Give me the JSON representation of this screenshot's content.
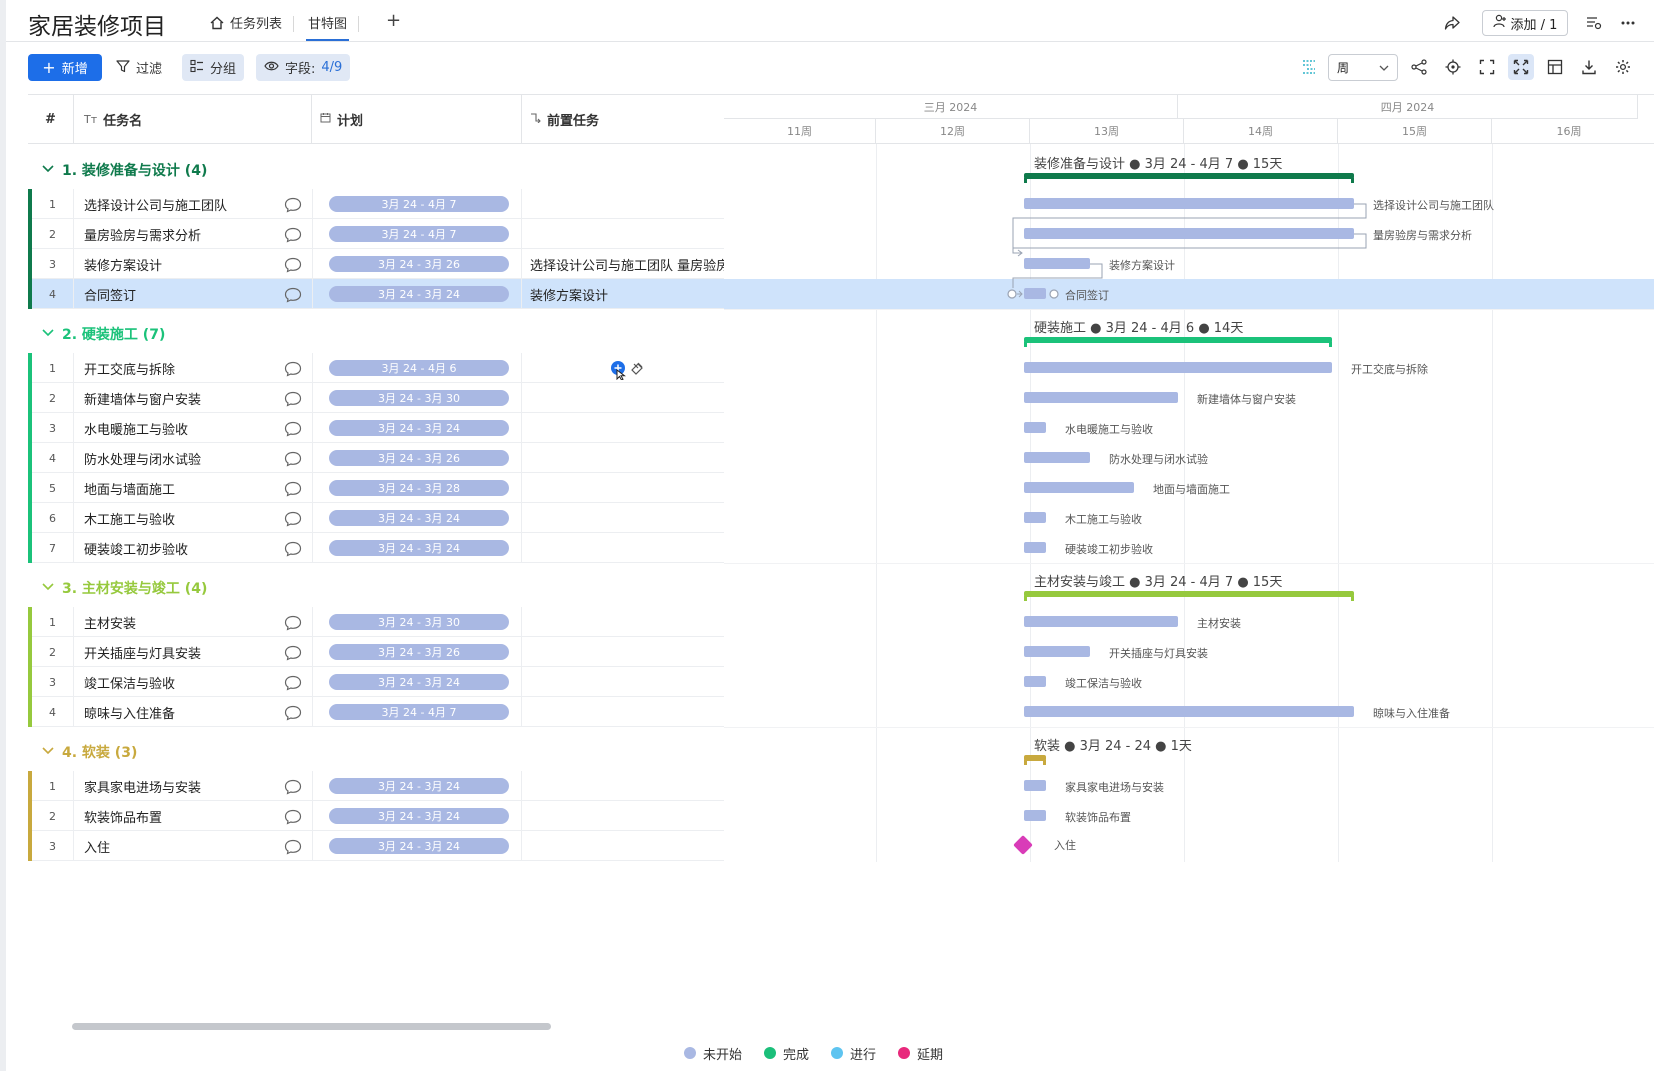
{
  "header": {
    "title": "家居装修项目",
    "tabs": [
      {
        "label": "任务列表"
      },
      {
        "label": "甘特图"
      }
    ],
    "add_label": "添加 / 1"
  },
  "toolbar": {
    "new_label": "新增",
    "filter_label": "过滤",
    "group_label": "分组",
    "fields_label": "字段:",
    "fields_count": "4/9",
    "view_select": "周"
  },
  "grid": {
    "columns": [
      {
        "label": "#"
      },
      {
        "label": "任务名"
      },
      {
        "label": "计划"
      },
      {
        "label": "前置任务"
      }
    ]
  },
  "timeline": {
    "months": [
      {
        "label": "三月 2024"
      },
      {
        "label": "四月 2024"
      }
    ],
    "weeks": [
      {
        "label": "11周"
      },
      {
        "label": "12周"
      },
      {
        "label": "13周"
      },
      {
        "label": "14周"
      },
      {
        "label": "15周"
      },
      {
        "label": "16周"
      }
    ]
  },
  "groups": [
    {
      "title": "1. 装修准备与设计 (4)",
      "color": "#0f7a4c",
      "summary": "装修准备与设计 ● 3月 24 - 4月 7 ● 15天",
      "tasks": [
        {
          "idx": "1",
          "name": "选择设计公司与施工团队",
          "plan": "3月 24 - 4月 7",
          "pred": ""
        },
        {
          "idx": "2",
          "name": "量房验房与需求分析",
          "plan": "3月 24 - 4月 7",
          "pred": ""
        },
        {
          "idx": "3",
          "name": "装修方案设计",
          "plan": "3月 24 - 3月 26",
          "pred": "选择设计公司与施工团队  量房验房与需求分析"
        },
        {
          "idx": "4",
          "name": "合同签订",
          "plan": "3月 24 - 3月 24",
          "pred": "装修方案设计"
        }
      ]
    },
    {
      "title": "2. 硬装施工 (7)",
      "color": "#1bc27a",
      "summary": "硬装施工 ● 3月 24 - 4月 6 ● 14天",
      "tasks": [
        {
          "idx": "1",
          "name": "开工交底与拆除",
          "plan": "3月 24 - 4月 6",
          "pred": ""
        },
        {
          "idx": "2",
          "name": "新建墙体与窗户安装",
          "plan": "3月 24 - 3月 30",
          "pred": ""
        },
        {
          "idx": "3",
          "name": "水电暖施工与验收",
          "plan": "3月 24 - 3月 24",
          "pred": ""
        },
        {
          "idx": "4",
          "name": "防水处理与闭水试验",
          "plan": "3月 24 - 3月 26",
          "pred": ""
        },
        {
          "idx": "5",
          "name": "地面与墙面施工",
          "plan": "3月 24 - 3月 28",
          "pred": ""
        },
        {
          "idx": "6",
          "name": "木工施工与验收",
          "plan": "3月 24 - 3月 24",
          "pred": ""
        },
        {
          "idx": "7",
          "name": "硬装竣工初步验收",
          "plan": "3月 24 - 3月 24",
          "pred": ""
        }
      ]
    },
    {
      "title": "3. 主材安装与竣工 (4)",
      "color": "#96c93d",
      "summary": "主材安装与竣工 ● 3月 24 - 4月 7 ● 15天",
      "tasks": [
        {
          "idx": "1",
          "name": "主材安装",
          "plan": "3月 24 - 3月 30",
          "pred": ""
        },
        {
          "idx": "2",
          "name": "开关插座与灯具安装",
          "plan": "3月 24 - 3月 26",
          "pred": ""
        },
        {
          "idx": "3",
          "name": "竣工保洁与验收",
          "plan": "3月 24 - 3月 24",
          "pred": ""
        },
        {
          "idx": "4",
          "name": "晾味与入住准备",
          "plan": "3月 24 - 4月 7",
          "pred": ""
        }
      ]
    },
    {
      "title": "4. 软装 (3)",
      "color": "#c8a93e",
      "summary": "软装 ● 3月 24 - 24 ● 1天",
      "tasks": [
        {
          "idx": "1",
          "name": "家具家电进场与安装",
          "plan": "3月 24 - 3月 24",
          "pred": ""
        },
        {
          "idx": "2",
          "name": "软装饰品布置",
          "plan": "3月 24 - 3月 24",
          "pred": ""
        },
        {
          "idx": "3",
          "name": "入住",
          "plan": "3月 24 - 3月 24",
          "pred": ""
        }
      ]
    }
  ],
  "legend": [
    {
      "label": "未开始",
      "color": "#a9b8e3"
    },
    {
      "label": "完成",
      "color": "#1bbf7a"
    },
    {
      "label": "进行",
      "color": "#5ec4f0"
    },
    {
      "label": "延期",
      "color": "#e8297c"
    }
  ],
  "colors": {
    "accent": "#1d6ee8",
    "bar": "#a9b8e3",
    "milestone": "#d93cb8",
    "selected_row": "#cfe3fb"
  }
}
